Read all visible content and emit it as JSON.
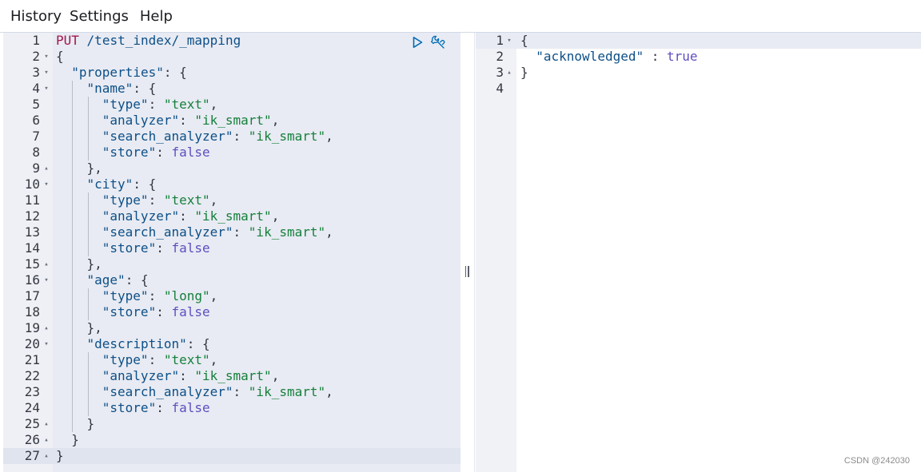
{
  "menu": [
    "History",
    "Settings",
    "Help"
  ],
  "editor": {
    "lines": [
      {
        "n": "1",
        "fold": "",
        "indent": 0,
        "tokens": [
          [
            "PUT",
            "method"
          ],
          [
            " ",
            "punc"
          ],
          [
            "/test_index/_mapping",
            "url"
          ]
        ]
      },
      {
        "n": "2",
        "fold": "open",
        "indent": 0,
        "tokens": [
          [
            "{",
            "punc"
          ]
        ]
      },
      {
        "n": "3",
        "fold": "open",
        "indent": 1,
        "tokens": [
          [
            "\"properties\"",
            "key"
          ],
          [
            ": {",
            "punc"
          ]
        ]
      },
      {
        "n": "4",
        "fold": "open",
        "indent": 2,
        "tokens": [
          [
            "\"name\"",
            "key"
          ],
          [
            ": {",
            "punc"
          ]
        ]
      },
      {
        "n": "5",
        "fold": "",
        "indent": 3,
        "tokens": [
          [
            "\"type\"",
            "key"
          ],
          [
            ": ",
            "punc"
          ],
          [
            "\"text\"",
            "str"
          ],
          [
            ",",
            "punc"
          ]
        ]
      },
      {
        "n": "6",
        "fold": "",
        "indent": 3,
        "tokens": [
          [
            "\"analyzer\"",
            "key"
          ],
          [
            ": ",
            "punc"
          ],
          [
            "\"ik_smart\"",
            "str"
          ],
          [
            ",",
            "punc"
          ]
        ]
      },
      {
        "n": "7",
        "fold": "",
        "indent": 3,
        "tokens": [
          [
            "\"search_analyzer\"",
            "key"
          ],
          [
            ": ",
            "punc"
          ],
          [
            "\"ik_smart\"",
            "str"
          ],
          [
            ",",
            "punc"
          ]
        ]
      },
      {
        "n": "8",
        "fold": "",
        "indent": 3,
        "tokens": [
          [
            "\"store\"",
            "key"
          ],
          [
            ": ",
            "punc"
          ],
          [
            "false",
            "kw"
          ]
        ]
      },
      {
        "n": "9",
        "fold": "close",
        "indent": 2,
        "tokens": [
          [
            "},",
            "punc"
          ]
        ]
      },
      {
        "n": "10",
        "fold": "open",
        "indent": 2,
        "tokens": [
          [
            "\"city\"",
            "key"
          ],
          [
            ": {",
            "punc"
          ]
        ]
      },
      {
        "n": "11",
        "fold": "",
        "indent": 3,
        "tokens": [
          [
            "\"type\"",
            "key"
          ],
          [
            ": ",
            "punc"
          ],
          [
            "\"text\"",
            "str"
          ],
          [
            ",",
            "punc"
          ]
        ]
      },
      {
        "n": "12",
        "fold": "",
        "indent": 3,
        "tokens": [
          [
            "\"analyzer\"",
            "key"
          ],
          [
            ": ",
            "punc"
          ],
          [
            "\"ik_smart\"",
            "str"
          ],
          [
            ",",
            "punc"
          ]
        ]
      },
      {
        "n": "13",
        "fold": "",
        "indent": 3,
        "tokens": [
          [
            "\"search_analyzer\"",
            "key"
          ],
          [
            ": ",
            "punc"
          ],
          [
            "\"ik_smart\"",
            "str"
          ],
          [
            ",",
            "punc"
          ]
        ]
      },
      {
        "n": "14",
        "fold": "",
        "indent": 3,
        "tokens": [
          [
            "\"store\"",
            "key"
          ],
          [
            ": ",
            "punc"
          ],
          [
            "false",
            "kw"
          ]
        ]
      },
      {
        "n": "15",
        "fold": "close",
        "indent": 2,
        "tokens": [
          [
            "},",
            "punc"
          ]
        ]
      },
      {
        "n": "16",
        "fold": "open",
        "indent": 2,
        "tokens": [
          [
            "\"age\"",
            "key"
          ],
          [
            ": {",
            "punc"
          ]
        ]
      },
      {
        "n": "17",
        "fold": "",
        "indent": 3,
        "tokens": [
          [
            "\"type\"",
            "key"
          ],
          [
            ": ",
            "punc"
          ],
          [
            "\"long\"",
            "str"
          ],
          [
            ",",
            "punc"
          ]
        ]
      },
      {
        "n": "18",
        "fold": "",
        "indent": 3,
        "tokens": [
          [
            "\"store\"",
            "key"
          ],
          [
            ": ",
            "punc"
          ],
          [
            "false",
            "kw"
          ]
        ]
      },
      {
        "n": "19",
        "fold": "close",
        "indent": 2,
        "tokens": [
          [
            "},",
            "punc"
          ]
        ]
      },
      {
        "n": "20",
        "fold": "open",
        "indent": 2,
        "tokens": [
          [
            "\"description\"",
            "key"
          ],
          [
            ": {",
            "punc"
          ]
        ]
      },
      {
        "n": "21",
        "fold": "",
        "indent": 3,
        "tokens": [
          [
            "\"type\"",
            "key"
          ],
          [
            ": ",
            "punc"
          ],
          [
            "\"text\"",
            "str"
          ],
          [
            ",",
            "punc"
          ]
        ]
      },
      {
        "n": "22",
        "fold": "",
        "indent": 3,
        "tokens": [
          [
            "\"analyzer\"",
            "key"
          ],
          [
            ": ",
            "punc"
          ],
          [
            "\"ik_smart\"",
            "str"
          ],
          [
            ",",
            "punc"
          ]
        ]
      },
      {
        "n": "23",
        "fold": "",
        "indent": 3,
        "tokens": [
          [
            "\"search_analyzer\"",
            "key"
          ],
          [
            ": ",
            "punc"
          ],
          [
            "\"ik_smart\"",
            "str"
          ],
          [
            ",",
            "punc"
          ]
        ]
      },
      {
        "n": "24",
        "fold": "",
        "indent": 3,
        "tokens": [
          [
            "\"store\"",
            "key"
          ],
          [
            ": ",
            "punc"
          ],
          [
            "false",
            "kw"
          ]
        ]
      },
      {
        "n": "25",
        "fold": "close",
        "indent": 2,
        "tokens": [
          [
            "}",
            "punc"
          ]
        ]
      },
      {
        "n": "26",
        "fold": "close",
        "indent": 1,
        "tokens": [
          [
            "}",
            "punc"
          ]
        ]
      },
      {
        "n": "27",
        "fold": "close",
        "indent": 0,
        "active": true,
        "tokens": [
          [
            "}",
            "punc"
          ]
        ]
      }
    ],
    "actions": [
      {
        "icon": "play-icon",
        "name": "send-request-button"
      },
      {
        "icon": "wrench-icon",
        "name": "request-settings-button"
      }
    ]
  },
  "output": {
    "lines": [
      {
        "n": "1",
        "fold": "open",
        "indent": 0,
        "active": true,
        "tokens": [
          [
            "{",
            "punc"
          ]
        ]
      },
      {
        "n": "2",
        "fold": "",
        "indent": 1,
        "tokens": [
          [
            "\"acknowledged\"",
            "key"
          ],
          [
            " : ",
            "punc"
          ],
          [
            "true",
            "kw"
          ]
        ]
      },
      {
        "n": "3",
        "fold": "close",
        "indent": 0,
        "tokens": [
          [
            "}",
            "punc"
          ]
        ]
      },
      {
        "n": "4",
        "fold": "",
        "indent": 0,
        "tokens": []
      }
    ]
  },
  "watermark": "CSDN @242030",
  "colors": {
    "method": "#a31549",
    "key": "#0d4f87",
    "string": "#16803c",
    "keyword": "#5d4fbf",
    "accent": "#006bb8"
  }
}
